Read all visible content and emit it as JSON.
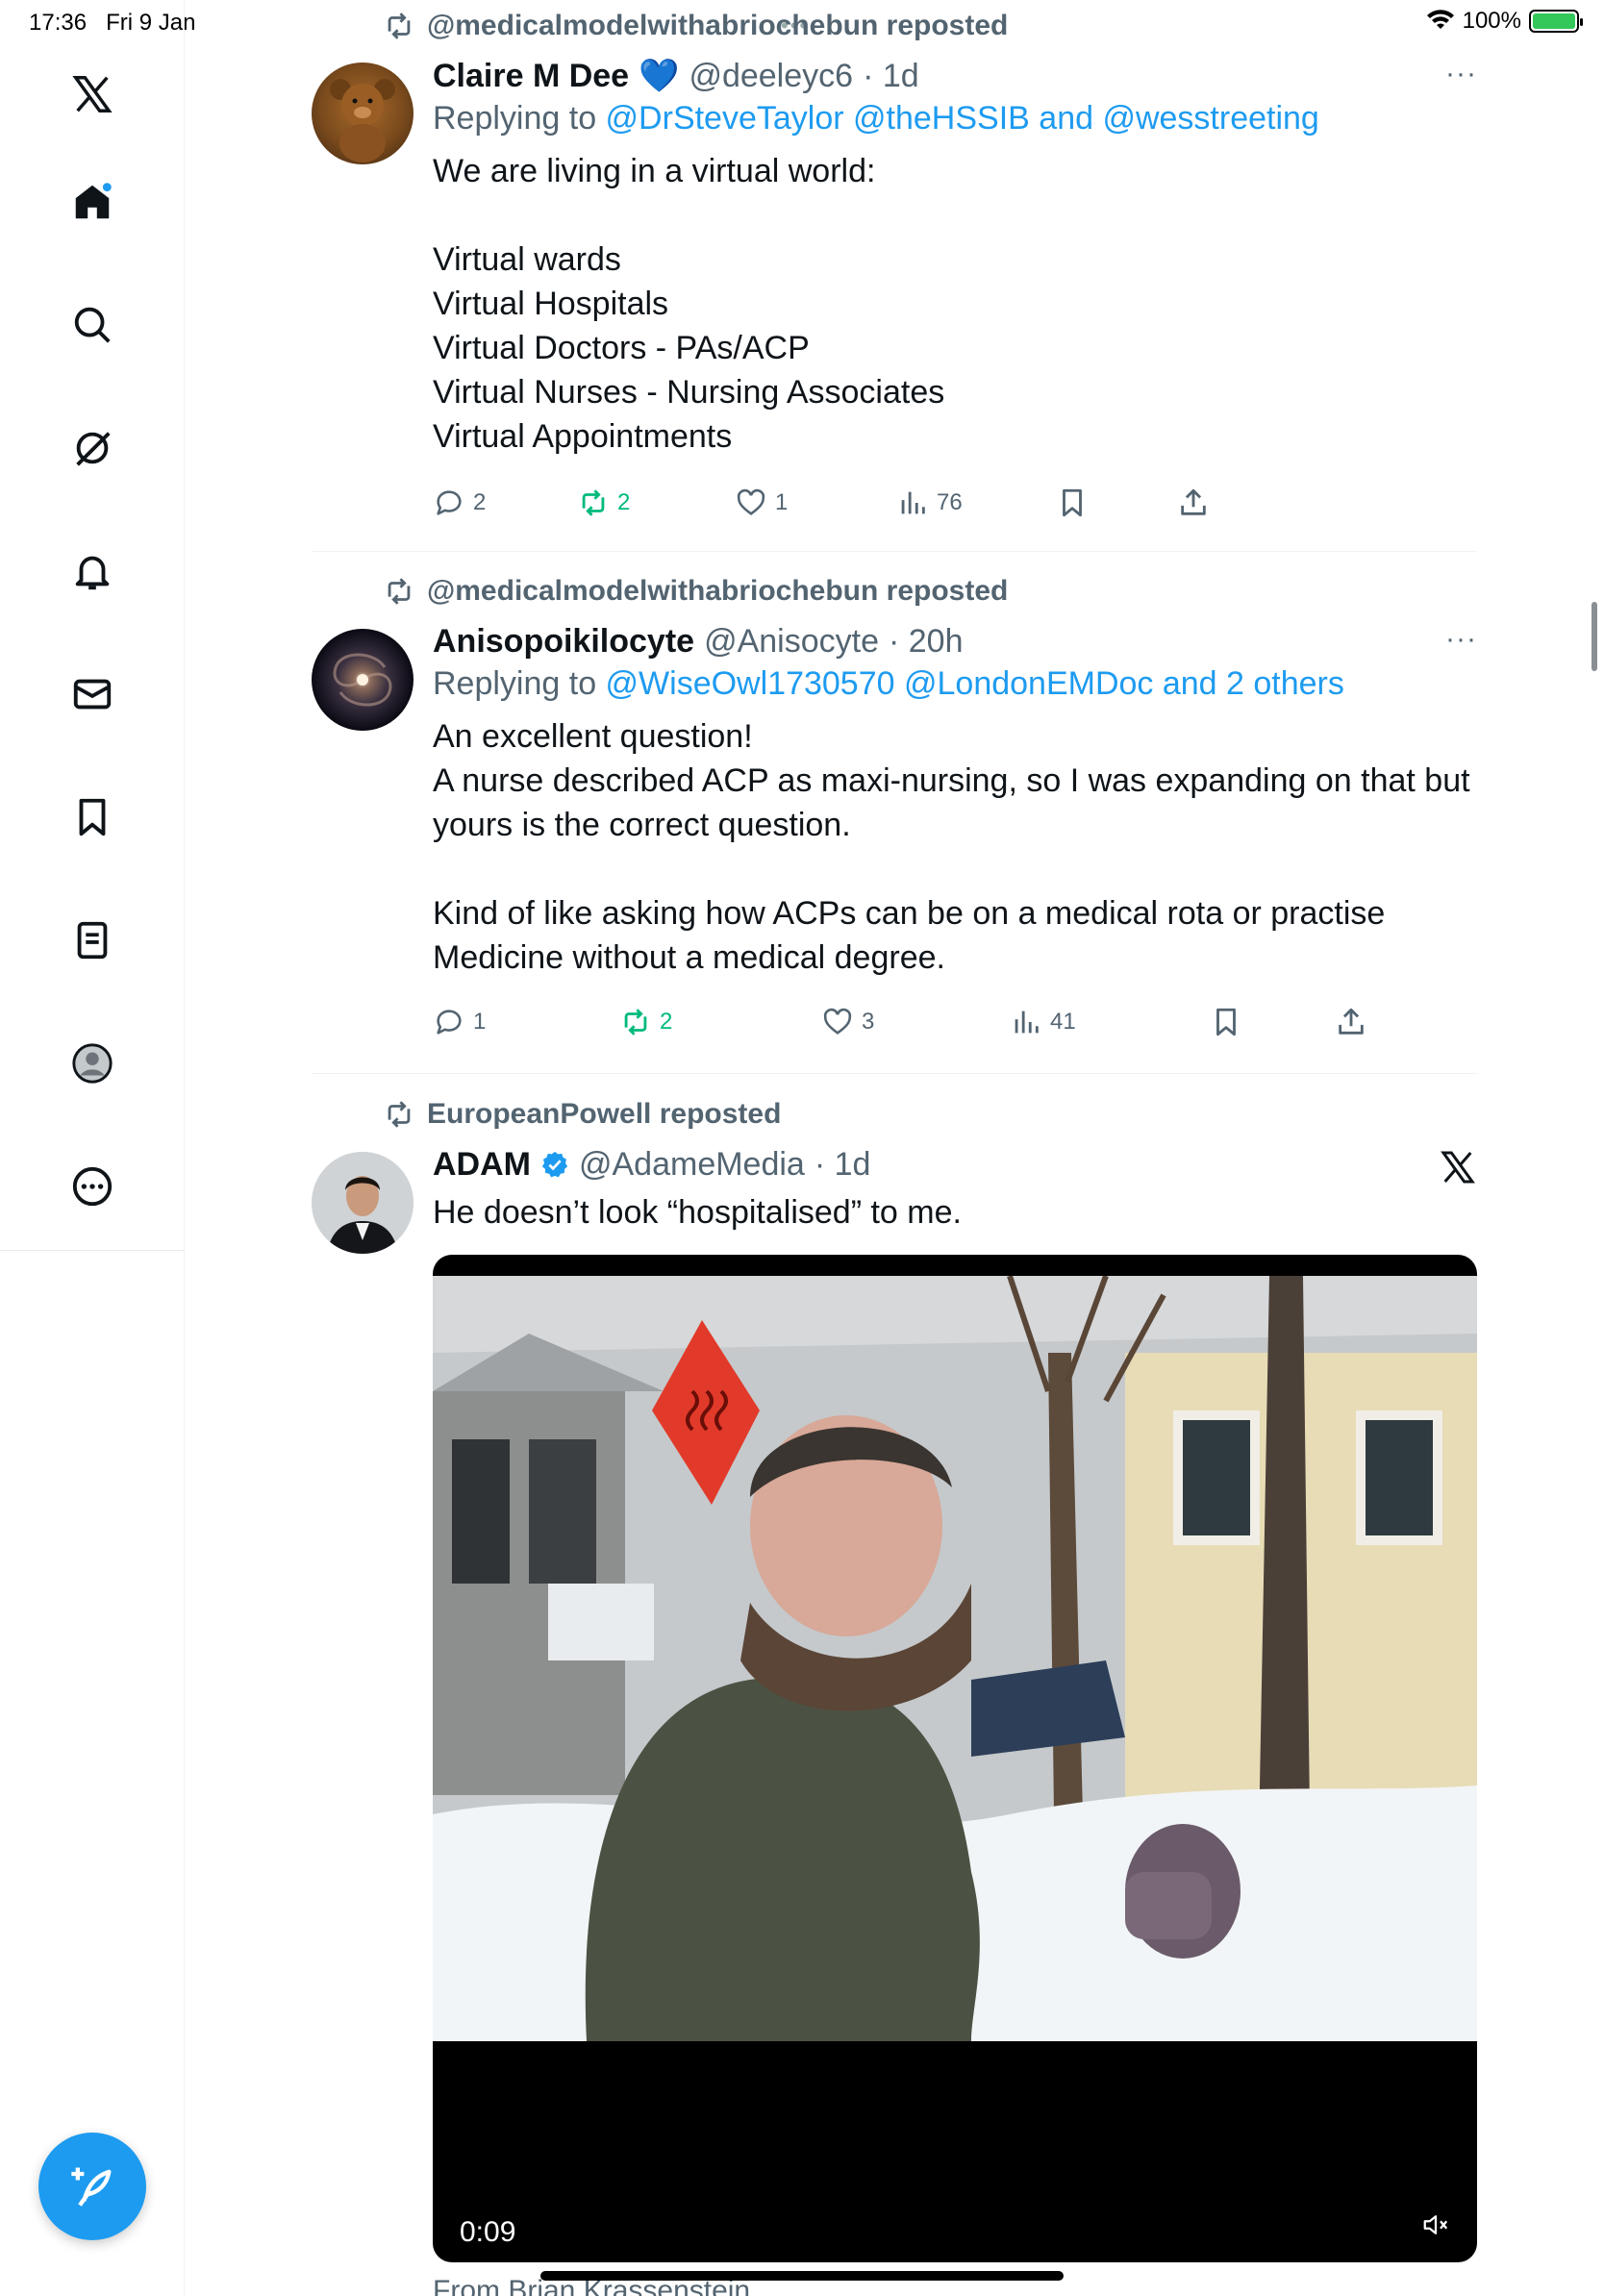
{
  "status_bar": {
    "time": "17:36",
    "date": "Fri 9 Jan",
    "battery": "100%"
  },
  "sidebar": {
    "items": [
      {
        "icon": "x-logo-icon"
      },
      {
        "icon": "home-icon"
      },
      {
        "icon": "search-icon"
      },
      {
        "icon": "grok-icon"
      },
      {
        "icon": "bell-icon"
      },
      {
        "icon": "mail-icon"
      },
      {
        "icon": "bookmark-icon"
      },
      {
        "icon": "lists-icon"
      },
      {
        "icon": "profile-icon"
      },
      {
        "icon": "more-icon"
      }
    ],
    "compose_icon": "feather-plus-icon"
  },
  "tweets": [
    {
      "reposted_by": "@medicalmodelwithabriochebun reposted",
      "name": "Claire M Dee",
      "heart_emoji": "💙",
      "handle": "@deeleyc6",
      "time": "· 1d",
      "reply_prefix": "Replying to ",
      "reply_mentions": "@DrSteveTaylor @theHSSIB and @wesstreeting",
      "text": "We are living in a virtual world:\n\nVirtual wards\nVirtual Hospitals\nVirtual Doctors - PAs/ACP\nVirtual Nurses - Nursing Associates\nVirtual Appointments",
      "replies": "2",
      "reposts": "2",
      "likes": "1",
      "views": "76",
      "more": "···"
    },
    {
      "reposted_by": "@medicalmodelwithabriochebun reposted",
      "name": "Anisopoikilocyte",
      "handle": "@Anisocyte",
      "time": "· 20h",
      "reply_prefix": "Replying to ",
      "reply_mentions": "@WiseOwl1730570 @LondonEMDoc and 2 others",
      "text": "An excellent question!\nA nurse described ACP as maxi-nursing, so I was expanding on that but\nyours is the correct question.\n\nKind of like asking how ACPs can be on a medical rota or practise\nMedicine without a medical degree.",
      "replies": "1",
      "reposts": "2",
      "likes": "3",
      "views": "41",
      "more": "···"
    },
    {
      "reposted_by": "EuropeanPowell reposted",
      "name": "ADAM",
      "handle": "@AdameMedia",
      "time": "· 1d",
      "text": "He doesn’t look “hospitalised” to me.",
      "video_duration": "0:09",
      "cutoff_text": "From Brian Krassenstein"
    }
  ]
}
